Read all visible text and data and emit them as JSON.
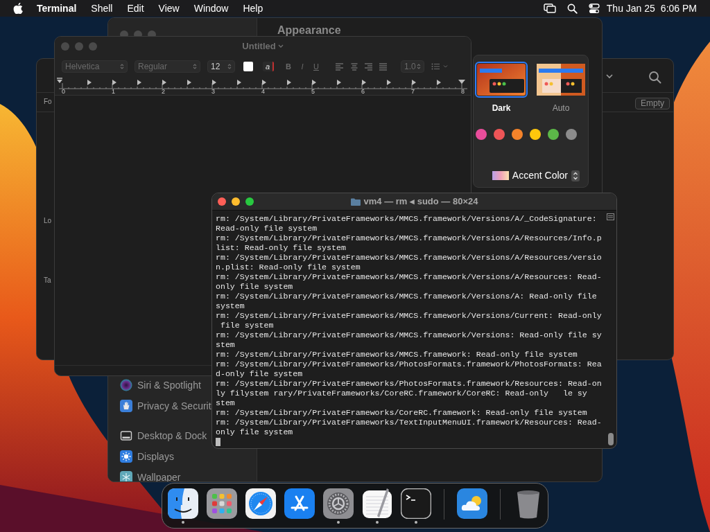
{
  "menu_bar": {
    "app": "Terminal",
    "menus": [
      "Shell",
      "Edit",
      "View",
      "Window",
      "Help"
    ],
    "date": "Thu Jan 25",
    "time": "6:06 PM"
  },
  "back_window": {
    "labels": [
      "Fo",
      "Lo",
      "Ta"
    ],
    "button": "Empty"
  },
  "settings_window": {
    "heading": "Appearance",
    "sidebar": [
      {
        "items": [
          {
            "label": "Siri & Spotlight",
            "kind": "siri"
          },
          {
            "label": "Privacy & Securit",
            "kind": "privacy"
          }
        ]
      },
      {
        "items": [
          {
            "label": "Desktop & Dock",
            "kind": "dock"
          },
          {
            "label": "Displays",
            "kind": "displays"
          },
          {
            "label": "Wallpaper",
            "kind": "wallpaper"
          }
        ]
      }
    ],
    "appearance_options": [
      {
        "label": "Dark",
        "kind": "dark",
        "selected": true
      },
      {
        "label": "Auto",
        "kind": "auto",
        "selected": false
      }
    ],
    "accent_colors": [
      {
        "color": "#e94d9b"
      },
      {
        "color": "#ee5557"
      },
      {
        "color": "#f5832a"
      },
      {
        "color": "#fdc70c"
      },
      {
        "color": "#5cb848"
      },
      {
        "color": "#8c8c8c"
      }
    ],
    "accent_label": "Accent Color"
  },
  "textedit_window": {
    "title": "Untitled",
    "font": "Helvetica",
    "style": "Regular",
    "size": "12",
    "color_button": "a",
    "style_buttons": [
      "B",
      "I",
      "U"
    ],
    "spacing": "1.0",
    "ruler": [
      "0",
      "1",
      "2",
      "3",
      "4",
      "5",
      "6",
      "7",
      "8"
    ]
  },
  "terminal_window": {
    "title": "vm4 — rm ◂ sudo — 80×24",
    "lines": [
      "rm: /System/Library/PrivateFrameworks/MMCS.framework/Versions/A/_CodeSignature:",
      "Read-only file system",
      "rm: /System/Library/PrivateFrameworks/MMCS.framework/Versions/A/Resources/Info.p",
      "list: Read-only file system",
      "rm: /System/Library/PrivateFrameworks/MMCS.framework/Versions/A/Resources/versio",
      "n.plist: Read-only file system",
      "rm: /System/Library/PrivateFrameworks/MMCS.framework/Versions/A/Resources: Read-",
      "only file system",
      "rm: /System/Library/PrivateFrameworks/MMCS.framework/Versions/A: Read-only file",
      "system",
      "rm: /System/Library/PrivateFrameworks/MMCS.framework/Versions/Current: Read-only",
      " file system",
      "rm: /System/Library/PrivateFrameworks/MMCS.framework/Versions: Read-only file sy",
      "stem",
      "rm: /System/Library/PrivateFrameworks/MMCS.framework: Read-only file system",
      "rm: /System/Library/PrivateFrameworks/PhotosFormats.framework/PhotosFormats: Rea",
      "d-only file system",
      "rm: /System/Library/PrivateFrameworks/PhotosFormats.framework/Resources: Read-on",
      "ly filystem rary/PrivateFrameworks/CoreRC.framework/CoreRC: Read-only   le sy",
      "stem",
      "rm: /System/Library/PrivateFrameworks/CoreRC.framework: Read-only file system",
      "rm: /System/Library/PrivateFrameworks/TextInputMenuUI.framework/Resources: Read-",
      "only file system"
    ]
  },
  "dock": {
    "groups": [
      {
        "items": [
          {
            "kind": "finder",
            "running": true
          },
          {
            "kind": "launchpad",
            "running": false
          },
          {
            "kind": "safari",
            "running": false
          },
          {
            "kind": "appstore",
            "running": false
          },
          {
            "kind": "settings",
            "running": true
          },
          {
            "kind": "textedit",
            "running": true
          },
          {
            "kind": "terminal",
            "running": true
          }
        ]
      },
      {
        "items": [
          {
            "kind": "weather",
            "running": false
          }
        ]
      },
      {
        "items": [
          {
            "kind": "trash",
            "running": false
          }
        ]
      }
    ]
  }
}
